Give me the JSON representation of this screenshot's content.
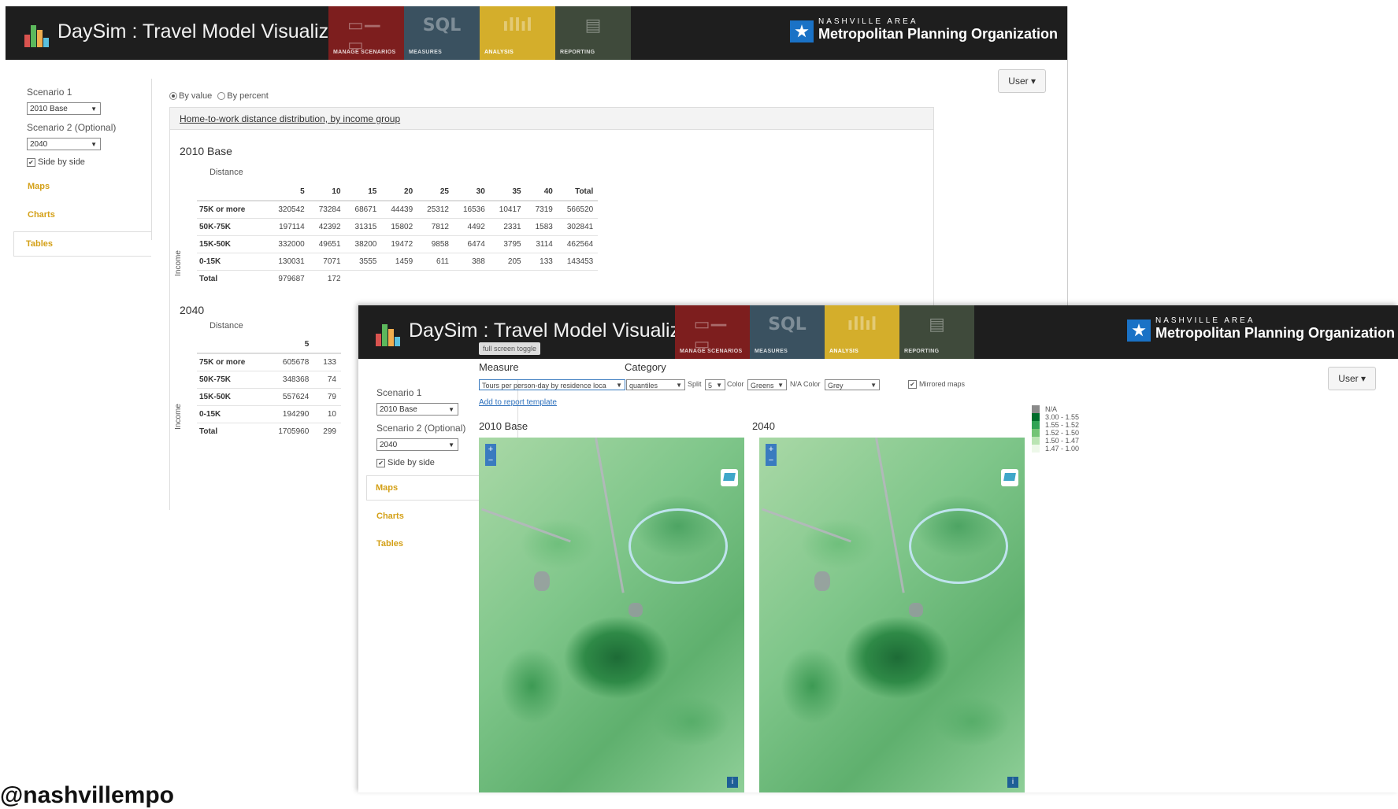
{
  "app": {
    "title": "DaySim : Travel Model Visualizer",
    "tiles": [
      {
        "label": "MANAGE SCENARIOS",
        "glyph": "▭—▭",
        "color": "#7d1e1e"
      },
      {
        "label": "MEASURES",
        "glyph": "SQL",
        "color": "#3a5160"
      },
      {
        "label": "ANALYSIS",
        "glyph": "ıllıl",
        "color": "#d4ae2b"
      },
      {
        "label": "REPORTING",
        "glyph": "▤",
        "color": "#3f4a3b"
      }
    ],
    "org_small": "NASHVILLE AREA",
    "org_big": "Metropolitan Planning Organization",
    "user_label": "User ▾"
  },
  "sidebar": {
    "scenario1_label": "Scenario 1",
    "scenario1_value": "2010 Base",
    "scenario2_label": "Scenario 2 (Optional)",
    "scenario2_value": "2040",
    "side_by_side": "Side by side",
    "nav": [
      "Maps",
      "Charts",
      "Tables"
    ]
  },
  "tables_view": {
    "radio_value": "By value",
    "radio_percent": "By percent",
    "panel_title": "Home-to-work distance distribution, by income group",
    "distance_label": "Distance",
    "income_label": "Income",
    "section1": {
      "title": "2010 Base",
      "columns": [
        "",
        "5",
        "10",
        "15",
        "20",
        "25",
        "30",
        "35",
        "40",
        "Total"
      ],
      "rows": [
        [
          "75K or more",
          "320542",
          "73284",
          "68671",
          "44439",
          "25312",
          "16536",
          "10417",
          "7319",
          "566520"
        ],
        [
          "50K-75K",
          "197114",
          "42392",
          "31315",
          "15802",
          "7812",
          "4492",
          "2331",
          "1583",
          "302841"
        ],
        [
          "15K-50K",
          "332000",
          "49651",
          "38200",
          "19472",
          "9858",
          "6474",
          "3795",
          "3114",
          "462564"
        ],
        [
          "0-15K",
          "130031",
          "7071",
          "3555",
          "1459",
          "611",
          "388",
          "205",
          "133",
          "143453"
        ],
        [
          "Total",
          "979687",
          "172",
          "",
          "",
          "",
          "",
          "",
          "",
          ""
        ]
      ]
    },
    "section2": {
      "title": "2040",
      "columns": [
        "",
        "5",
        ""
      ],
      "rows": [
        [
          "75K or more",
          "605678",
          "133"
        ],
        [
          "50K-75K",
          "348368",
          "74"
        ],
        [
          "15K-50K",
          "557624",
          "79"
        ],
        [
          "0-15K",
          "194290",
          "10"
        ],
        [
          "Total",
          "1705960",
          "299"
        ]
      ]
    }
  },
  "maps_view": {
    "fullscreen_toggle": "full screen toggle",
    "measure_label": "Measure",
    "category_label": "Category",
    "measure_value": "Tours per person-day by residence loca",
    "method_value": "quantiles",
    "split_label": "Split",
    "split_value": "5",
    "color_label": "Color",
    "color_value": "Greens",
    "na_color_label": "N/A Color",
    "na_color_value": "Grey",
    "mirrored_label": "Mirrored maps",
    "add_report": "Add to report template",
    "map1_title": "2010 Base",
    "map2_title": "2040",
    "zoom_in": "+",
    "zoom_out": "−",
    "info": "i",
    "legend": [
      {
        "label": "N/A",
        "color": "#8a8a8a"
      },
      {
        "label": "3.00 - 1.55",
        "color": "#006d2c"
      },
      {
        "label": "1.55 - 1.52",
        "color": "#31a354"
      },
      {
        "label": "1.52 - 1.50",
        "color": "#74c476"
      },
      {
        "label": "1.50 - 1.47",
        "color": "#bae4b3"
      },
      {
        "label": "1.47 - 1.00",
        "color": "#edf8e9"
      }
    ]
  },
  "footer_text": "@nashvillempo"
}
